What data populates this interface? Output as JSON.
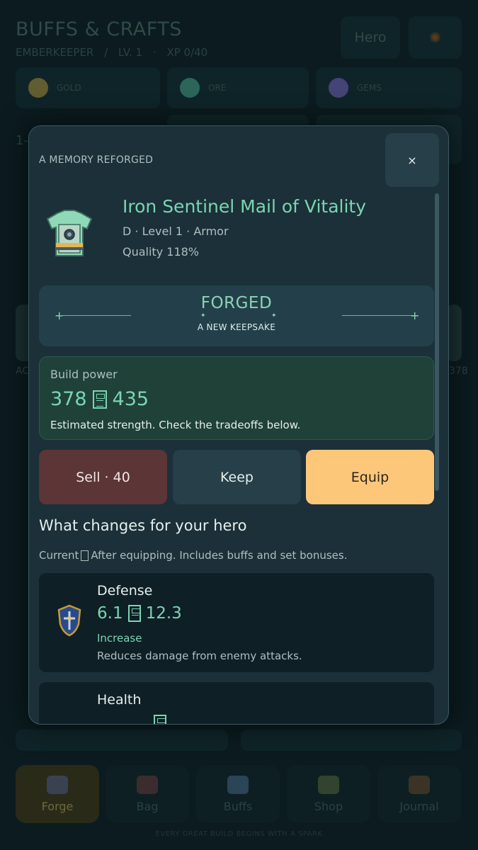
{
  "background": {
    "title": "BUFFS & CRAFTS",
    "subtitle": [
      "EMBERKEEPER",
      "/",
      "LV. 1",
      "·",
      "XP 0/40"
    ],
    "hero_button": "Hero",
    "resources": [
      {
        "label": "GOLD",
        "icon": "gold-coins-icon",
        "color": "#c8a53a"
      },
      {
        "label": "ORE",
        "icon": "ore-crystal-icon",
        "color": "#4fb89a"
      },
      {
        "label": "GEMS",
        "icon": "gems-icon",
        "color": "#8a6bd6"
      }
    ],
    "edge_texts": [
      "1-",
      "AC",
      "378"
    ],
    "nav": [
      {
        "label": "Forge",
        "icon": "anvil-icon",
        "active": true
      },
      {
        "label": "Bag",
        "icon": "bag-icon",
        "active": false
      },
      {
        "label": "Buffs",
        "icon": "buffs-icon",
        "active": false
      },
      {
        "label": "Shop",
        "icon": "shop-icon",
        "active": false
      },
      {
        "label": "Journal",
        "icon": "journal-icon",
        "active": false
      }
    ],
    "tagline": "EVERY GREAT BUILD BEGINS WITH A SPARK"
  },
  "modal": {
    "heading": "A MEMORY REFORGED",
    "close_label": "×",
    "item": {
      "name": "Iron Sentinel Mail of Vitality",
      "meta": "D · Level 1 · Armor",
      "quality": "Quality 118%",
      "icon": "armor-icon"
    },
    "forged": {
      "title": "FORGED",
      "subtitle": "A NEW KEEPSAKE"
    },
    "power": {
      "label": "Build power",
      "current": "378",
      "after": "435",
      "note": "Estimated strength. Check the tradeoffs below."
    },
    "actions": {
      "sell": "Sell · 40",
      "keep": "Keep",
      "equip": "Equip"
    },
    "changes": {
      "title": "What changes for your hero",
      "note_current": "Current",
      "note_after": "After equipping. Includes buffs and set bonuses."
    },
    "stats": [
      {
        "name": "Defense",
        "current": "6.1",
        "after": "12.3",
        "change": "Increase",
        "description": "Reduces damage from enemy attacks.",
        "icon": "shield-icon"
      },
      {
        "name": "Health",
        "current": "",
        "after": "",
        "change": "",
        "description": "",
        "icon": "heart-icon"
      }
    ]
  },
  "colors": {
    "accent_green": "#7bd4b2",
    "equip": "#fdc77a",
    "sell": "#5c3536"
  }
}
